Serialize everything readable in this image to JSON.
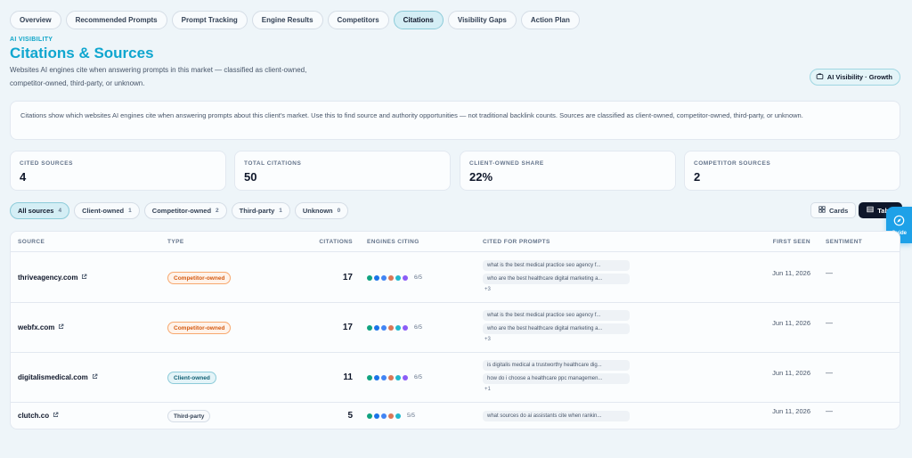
{
  "tabs": [
    {
      "label": "Overview"
    },
    {
      "label": "Recommended Prompts"
    },
    {
      "label": "Prompt Tracking"
    },
    {
      "label": "Engine Results"
    },
    {
      "label": "Competitors"
    },
    {
      "label": "Citations",
      "active": true
    },
    {
      "label": "Visibility Gaps"
    },
    {
      "label": "Action Plan"
    }
  ],
  "header": {
    "eyebrow": "AI VISIBILITY",
    "title": "Citations & Sources",
    "subtitle": "Websites AI engines cite when answering prompts in this market — classified as client-owned, competitor-owned, third-party, or unknown.",
    "plan_badge": "AI Visibility · Growth",
    "plan_icon": "briefcase-icon"
  },
  "info": "Citations show which websites AI engines cite when answering prompts about this client's market. Use this to find source and authority opportunities — not traditional backlink counts. Sources are classified as client-owned, competitor-owned, third-party, or unknown.",
  "stats": [
    {
      "label": "CITED SOURCES",
      "value": "4"
    },
    {
      "label": "TOTAL CITATIONS",
      "value": "50"
    },
    {
      "label": "CLIENT-OWNED SHARE",
      "value": "22%"
    },
    {
      "label": "COMPETITOR SOURCES",
      "value": "2"
    }
  ],
  "filters": [
    {
      "label": "All sources",
      "count": "4",
      "active": true
    },
    {
      "label": "Client-owned",
      "count": "1"
    },
    {
      "label": "Competitor-owned",
      "count": "2"
    },
    {
      "label": "Third-party",
      "count": "1"
    },
    {
      "label": "Unknown",
      "count": "0"
    }
  ],
  "view": {
    "cards": "Cards",
    "table": "Table",
    "cards_icon": "grid-icon",
    "table_icon": "table-icon"
  },
  "guide": {
    "label": "Guide",
    "icon": "compass-icon"
  },
  "table": {
    "columns": {
      "source": "SOURCE",
      "type": "TYPE",
      "citations": "CITATIONS",
      "engines": "ENGINES CITING",
      "prompts": "CITED FOR PROMPTS",
      "first_seen": "FIRST SEEN",
      "sentiment": "SENTIMENT"
    },
    "engine_colors": [
      "#10a37f",
      "#1a73e8",
      "#4285f4",
      "#d97757",
      "#20b8cd",
      "#8b5cf6",
      "#111111"
    ],
    "rows": [
      {
        "source": "thriveagency.com",
        "type": "Competitor-owned",
        "type_class": "competitor",
        "citations": "17",
        "engine_dots": 6,
        "engines_label": "6/5",
        "prompts": [
          "what is the best medical practice seo agency f...",
          "who are the best healthcare digital marketing a..."
        ],
        "more": "+3",
        "first_seen": "Jun 11, 2026",
        "sentiment": "—"
      },
      {
        "source": "webfx.com",
        "type": "Competitor-owned",
        "type_class": "competitor",
        "citations": "17",
        "engine_dots": 6,
        "engines_label": "6/5",
        "prompts": [
          "what is the best medical practice seo agency f...",
          "who are the best healthcare digital marketing a..."
        ],
        "more": "+3",
        "first_seen": "Jun 11, 2026",
        "sentiment": "—"
      },
      {
        "source": "digitalismedical.com",
        "type": "Client-owned",
        "type_class": "client",
        "citations": "11",
        "engine_dots": 6,
        "engines_label": "6/5",
        "prompts": [
          "is digitalis medical a trustworthy healthcare dig...",
          "how do i choose a healthcare ppc managemen..."
        ],
        "more": "+1",
        "first_seen": "Jun 11, 2026",
        "sentiment": "—"
      },
      {
        "source": "clutch.co",
        "type": "Third-party",
        "type_class": "third",
        "citations": "5",
        "engine_dots": 5,
        "engines_label": "5/5",
        "prompts": [
          "what sources do ai assistants cite when rankin..."
        ],
        "more": "",
        "first_seen": "Jun 11, 2026",
        "sentiment": "—"
      }
    ]
  }
}
